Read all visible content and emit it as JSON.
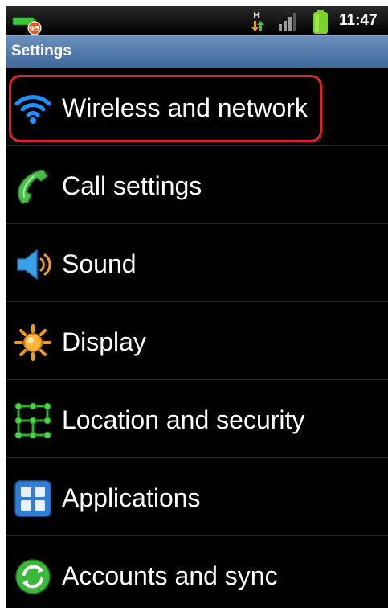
{
  "status_bar": {
    "notification_badge": "95",
    "network_type": "H",
    "time": "11:47",
    "icons": [
      "battery-notification-icon",
      "hspa-data-icon",
      "signal-strength-icon",
      "battery-icon"
    ]
  },
  "title_bar": {
    "title": "Settings",
    "color": "#5079ad"
  },
  "settings_list": {
    "selected_index": 0,
    "highlight_color": "#e0202a",
    "items": [
      {
        "label": "Wireless and network",
        "icon": "wifi-icon"
      },
      {
        "label": "Call settings",
        "icon": "phone-handset-icon"
      },
      {
        "label": "Sound",
        "icon": "speaker-icon"
      },
      {
        "label": "Display",
        "icon": "brightness-icon"
      },
      {
        "label": "Location and security",
        "icon": "grid-lock-icon"
      },
      {
        "label": "Applications",
        "icon": "applications-grid-icon"
      },
      {
        "label": "Accounts and sync",
        "icon": "sync-icon"
      }
    ]
  }
}
